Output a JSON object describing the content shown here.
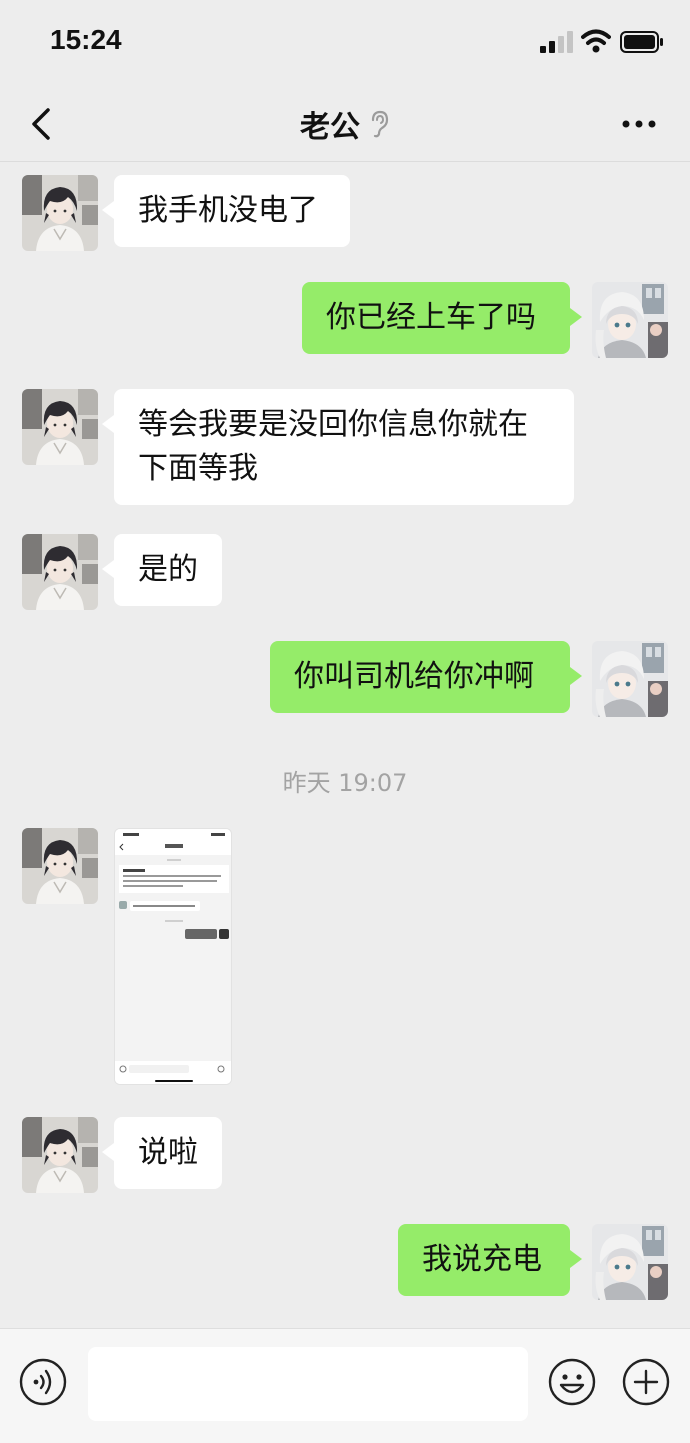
{
  "status_bar": {
    "time": "15:24",
    "signal_icon": "signal-bars-icon",
    "wifi_icon": "wifi-icon",
    "battery_icon": "battery-icon"
  },
  "header": {
    "title": "老公",
    "back_icon": "chevron-left-icon",
    "mute_icon": "ear-icon",
    "more_icon": "more-dots-icon"
  },
  "messages": [
    {
      "side": "in",
      "text": "我手机没电了"
    },
    {
      "side": "out",
      "text": "你已经上车了吗"
    },
    {
      "side": "in",
      "text": "等会我要是没回你信息你就在下面等我"
    },
    {
      "side": "in",
      "text": "是的"
    },
    {
      "side": "out",
      "text": "你叫司机给你冲啊"
    },
    {
      "side": "time",
      "text": "昨天 19:07"
    },
    {
      "side": "in",
      "type": "image",
      "text": ""
    },
    {
      "side": "in",
      "text": "说啦"
    },
    {
      "side": "out",
      "text": "我说充电"
    }
  ],
  "input_bar": {
    "voice_icon": "voice-icon",
    "emoji_icon": "emoji-icon",
    "plus_icon": "plus-circle-icon",
    "value": ""
  },
  "colors": {
    "background": "#ededed",
    "outgoing_bubble": "#95ec69",
    "incoming_bubble": "#ffffff",
    "timestamp": "#a3a3a3"
  }
}
